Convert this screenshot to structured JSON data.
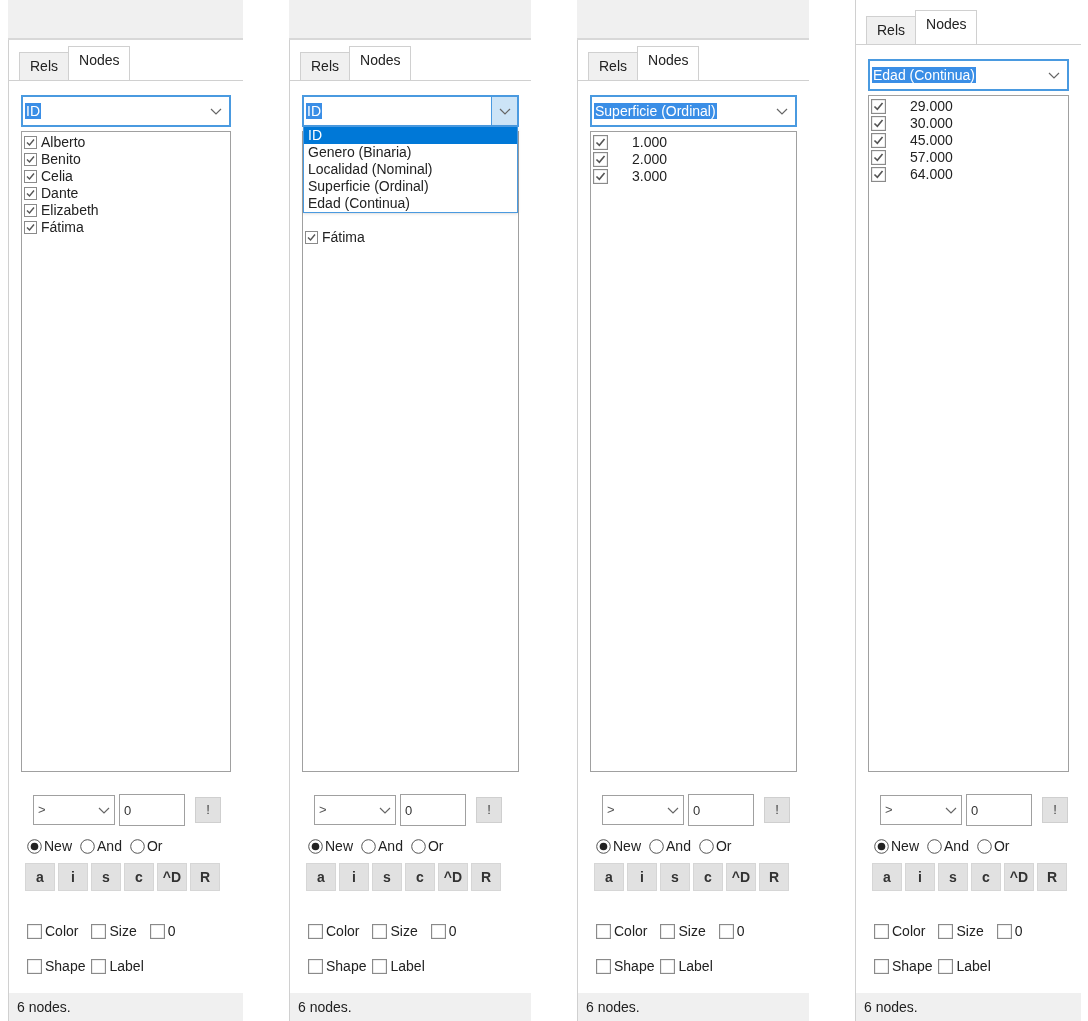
{
  "panels": [
    {
      "tabs": [
        {
          "label": "Rels",
          "selected": false
        },
        {
          "label": "Nodes",
          "selected": true
        }
      ],
      "combo": {
        "value": "ID",
        "open": false
      },
      "items": [
        {
          "kind": "name",
          "label": "Alberto",
          "checked": true
        },
        {
          "kind": "name",
          "label": "Benito",
          "checked": true
        },
        {
          "kind": "name",
          "label": "Celia",
          "checked": true
        },
        {
          "kind": "name",
          "label": "Dante",
          "checked": true
        },
        {
          "kind": "name",
          "label": "Elizabeth",
          "checked": true
        },
        {
          "kind": "name",
          "label": "Fátima",
          "checked": true
        }
      ],
      "filter": {
        "operator": ">",
        "value": "0",
        "button": "!"
      },
      "modes": [
        {
          "label": "New",
          "selected": true
        },
        {
          "label": "And",
          "selected": false
        },
        {
          "label": "Or",
          "selected": false
        }
      ],
      "tool_buttons": [
        "a",
        "i",
        "s",
        "c",
        "^D",
        "R"
      ],
      "toggles": [
        {
          "label": "Color",
          "checked": false
        },
        {
          "label": "Size",
          "checked": false
        },
        {
          "label": "0",
          "checked": false
        },
        {
          "label": "Shape",
          "checked": false
        },
        {
          "label": "Label",
          "checked": false
        }
      ],
      "status": "6 nodes."
    },
    {
      "tabs": [
        {
          "label": "Rels",
          "selected": false
        },
        {
          "label": "Nodes",
          "selected": true
        }
      ],
      "combo": {
        "value": "ID",
        "open": true
      },
      "options": [
        {
          "label": "ID",
          "selected": true
        },
        {
          "label": "Genero (Binaria)",
          "selected": false
        },
        {
          "label": "Localidad (Nominal)",
          "selected": false
        },
        {
          "label": "Superficie (Ordinal)",
          "selected": false
        },
        {
          "label": "Edad (Continua)",
          "selected": false
        }
      ],
      "items": [
        {
          "kind": "name",
          "label": "Fátima",
          "checked": true
        }
      ],
      "filter": {
        "operator": ">",
        "value": "0",
        "button": "!"
      },
      "modes": [
        {
          "label": "New",
          "selected": true
        },
        {
          "label": "And",
          "selected": false
        },
        {
          "label": "Or",
          "selected": false
        }
      ],
      "tool_buttons": [
        "a",
        "i",
        "s",
        "c",
        "^D",
        "R"
      ],
      "toggles": [
        {
          "label": "Color",
          "checked": false
        },
        {
          "label": "Size",
          "checked": false
        },
        {
          "label": "0",
          "checked": false
        },
        {
          "label": "Shape",
          "checked": false
        },
        {
          "label": "Label",
          "checked": false
        }
      ],
      "status": "6 nodes."
    },
    {
      "tabs": [
        {
          "label": "Rels",
          "selected": false
        },
        {
          "label": "Nodes",
          "selected": true
        }
      ],
      "combo": {
        "value": "Superficie (Ordinal)",
        "open": false
      },
      "items": [
        {
          "kind": "number",
          "label": "1.000",
          "checked": true
        },
        {
          "kind": "number",
          "label": "2.000",
          "checked": true
        },
        {
          "kind": "number",
          "label": "3.000",
          "checked": true
        }
      ],
      "filter": {
        "operator": ">",
        "value": "0",
        "button": "!"
      },
      "modes": [
        {
          "label": "New",
          "selected": true
        },
        {
          "label": "And",
          "selected": false
        },
        {
          "label": "Or",
          "selected": false
        }
      ],
      "tool_buttons": [
        "a",
        "i",
        "s",
        "c",
        "^D",
        "R"
      ],
      "toggles": [
        {
          "label": "Color",
          "checked": false
        },
        {
          "label": "Size",
          "checked": false
        },
        {
          "label": "0",
          "checked": false
        },
        {
          "label": "Shape",
          "checked": false
        },
        {
          "label": "Label",
          "checked": false
        }
      ],
      "status": "6 nodes."
    },
    {
      "tabs": [
        {
          "label": "Rels",
          "selected": false
        },
        {
          "label": "Nodes",
          "selected": true
        }
      ],
      "combo": {
        "value": "Edad (Continua)",
        "open": false
      },
      "items": [
        {
          "kind": "number",
          "label": "29.000",
          "checked": true
        },
        {
          "kind": "number",
          "label": "30.000",
          "checked": true
        },
        {
          "kind": "number",
          "label": "45.000",
          "checked": true
        },
        {
          "kind": "number",
          "label": "57.000",
          "checked": true
        },
        {
          "kind": "number",
          "label": "64.000",
          "checked": true
        }
      ],
      "filter": {
        "operator": ">",
        "value": "0",
        "button": "!"
      },
      "modes": [
        {
          "label": "New",
          "selected": true
        },
        {
          "label": "And",
          "selected": false
        },
        {
          "label": "Or",
          "selected": false
        }
      ],
      "tool_buttons": [
        "a",
        "i",
        "s",
        "c",
        "^D",
        "R"
      ],
      "toggles": [
        {
          "label": "Color",
          "checked": false
        },
        {
          "label": "Size",
          "checked": false
        },
        {
          "label": "0",
          "checked": false
        },
        {
          "label": "Shape",
          "checked": false
        },
        {
          "label": "Label",
          "checked": false
        }
      ],
      "status": "6 nodes."
    }
  ]
}
